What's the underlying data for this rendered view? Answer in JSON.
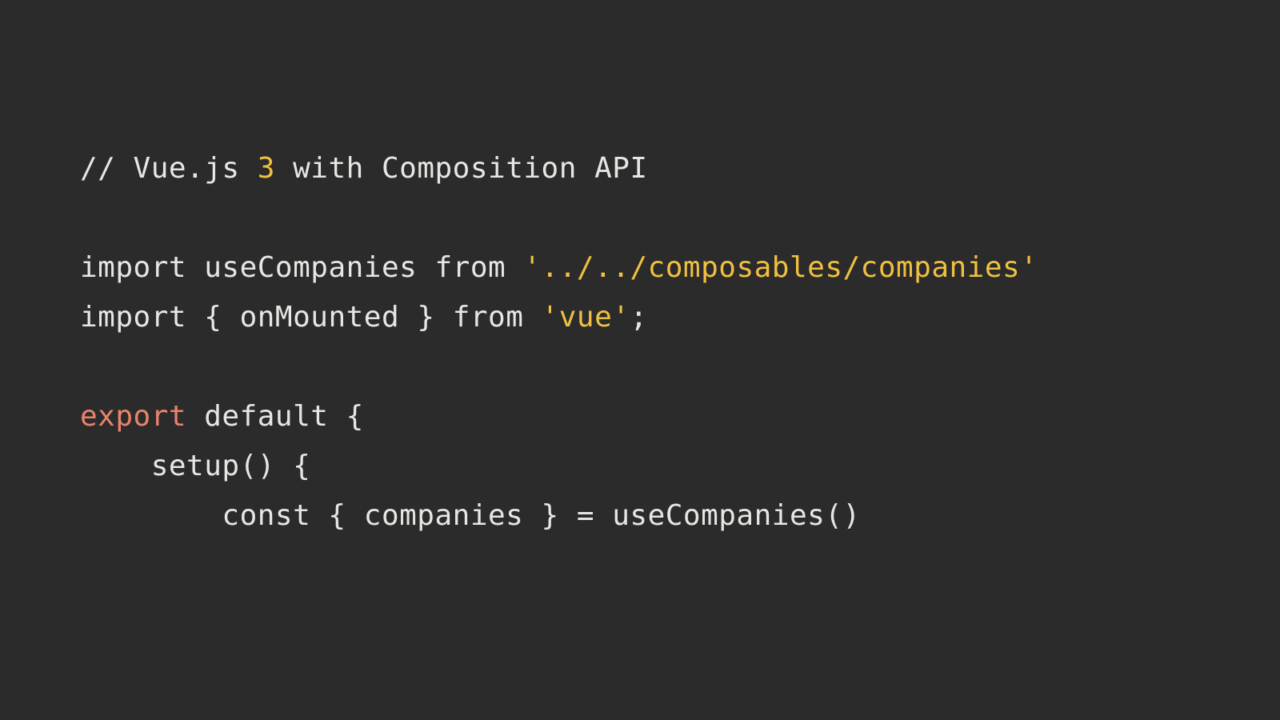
{
  "code": {
    "line1": {
      "comment_prefix": "// Vue.js ",
      "version_number": "3",
      "comment_suffix": " with Composition API"
    },
    "line3": {
      "import_kw": "import",
      "name": " useCompanies ",
      "from_kw": "from ",
      "path": "'../../composables/companies'"
    },
    "line4": {
      "import_kw": "import",
      "brace_open": " { ",
      "name": "onMounted",
      "brace_close": " } ",
      "from_kw": "from ",
      "path": "'vue'",
      "semi": ";"
    },
    "line6": {
      "export_kw": "export",
      "rest": " default {"
    },
    "line7": {
      "text": "    setup() {"
    },
    "line8": {
      "text": "        const { companies } = useCompanies()"
    }
  }
}
